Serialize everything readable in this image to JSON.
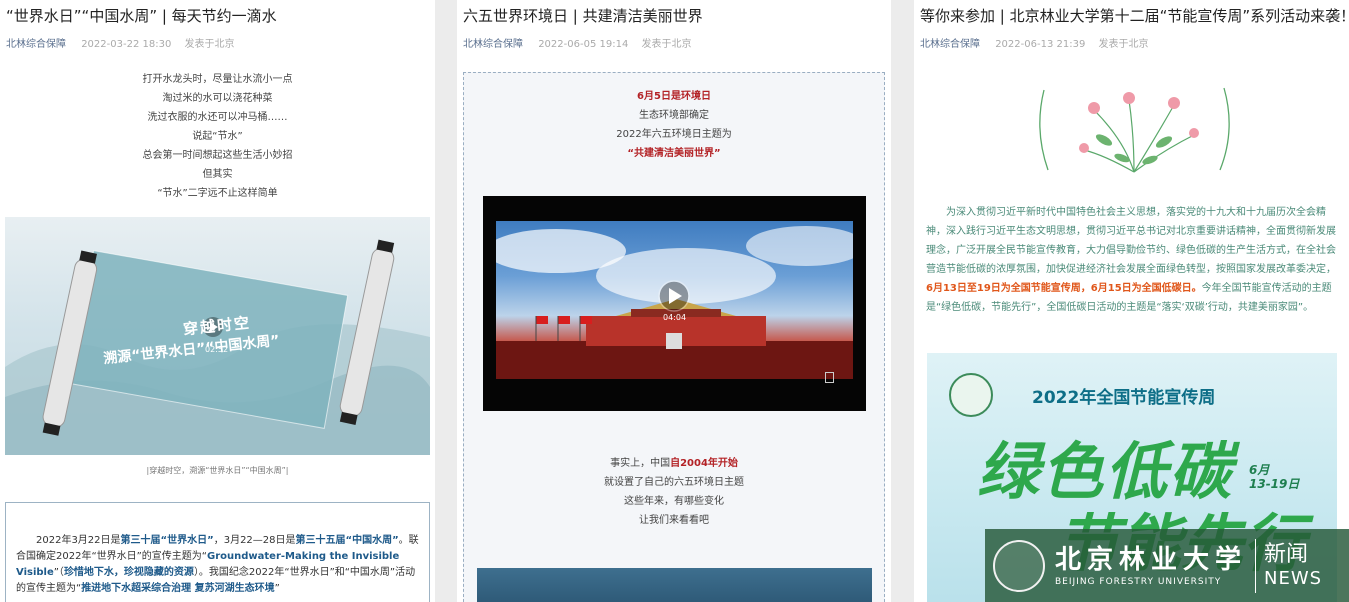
{
  "articles": [
    {
      "title": "“世界水日”“中国水周” | 每天节约一滴水",
      "source": "北林综合保障",
      "time": "2022-03-22 18:30",
      "location": "发表于北京",
      "lines": [
        "打开水龙头时，尽量让水流小一点",
        "淘过米的水可以浇花种菜",
        "洗过衣服的水还可以冲马桶……",
        "说起“节水”",
        "总会第一时间想起这些生活小妙招",
        "但其实",
        "“节水”二字远不止这样简单"
      ],
      "image_text": {
        "line1": "穿越时空",
        "line2": "溯源“世界水日”“中国水周”",
        "duration": "02:52"
      },
      "caption": "|穿越时空，溯源“世界水日”“中国水周”|",
      "para": {
        "p1": "2022年3月22日是",
        "h1": "第三十届“世界水日”",
        "p2": "，3月22—28日是",
        "h2": "第三十五届“中国水周”",
        "p3": "。联合国确定2022年“世界水日”的宣传主题为“",
        "h3": "Groundwater-Making the Invisible Visible",
        "p4": "”（",
        "h4": "珍惜地下水，珍视隐藏的资源",
        "p5": "）。我国纪念2022年“世界水日”和“中国水周”活动的宣传主题为“",
        "h5": "推进地下水超采综合治理 复苏河湖生态环境",
        "p6": "”"
      }
    },
    {
      "title": "六五世界环境日 | 共建清洁美丽世界",
      "source": "北林综合保障",
      "time": "2022-06-05 19:14",
      "location": "发表于北京",
      "lines_top": {
        "l1": "6月5日是环境日",
        "l2": "生态环境部确定",
        "l3": "2022年六五环境日主题为",
        "l4": "“共建清洁美丽世界”"
      },
      "video": {
        "duration": "04:04"
      },
      "lines_bottom": {
        "l1a": "事实上，中国",
        "l1b": "自2004年开始",
        "l2": "就设置了自己的六五环境日主题",
        "l3": "这些年来，有哪些变化",
        "l4": "让我们来看看吧"
      }
    },
    {
      "title": "等你来参加 | 北京林业大学第十二届“节能宣传周”系列活动来袭！",
      "source": "北林综合保障",
      "time": "2022-06-13 21:39",
      "location": "发表于北京",
      "para": {
        "p1": "为深入贯彻习近平新时代中国特色社会主义思想，落实党的十九大和十九届历次全会精神，深入践行习近平生态文明思想，贯彻习近平总书记对北京重要讲话精神，全面贯彻新发展理念，广泛开展全民节能宣传教育，大力倡导勤俭节约、绿色低碳的生产生活方式，在全社会营造节能低碳的浓厚氛围，加快促进经济社会发展全面绿色转型，按照国家发展改革委决定，",
        "h1": "6月13日至19日为全国节能宣传周，6月15日为全国低碳日。",
        "p2": "今年全国节能宣传活动的主题是“绿色低碳，节能先行”，全国低碳日活动的主题是“落实‘双碳’行动，共建美丽家园”。"
      },
      "banner": {
        "title": "2022年全国节能宣传周",
        "big1": "绿色低碳",
        "big2": "节能先行",
        "date1": "6月",
        "date2": "13-19日"
      }
    }
  ],
  "watermark": {
    "cn": "北京林业大学",
    "en": "BEIJING FORESTRY UNIVERSITY",
    "news_cn": "新闻",
    "news_en": "NEWS"
  },
  "colors": {
    "highlight_blue": "#1e5a8a",
    "highlight_red": "#b32226",
    "highlight_orange": "#e0561a",
    "green": "#2ea84c"
  }
}
